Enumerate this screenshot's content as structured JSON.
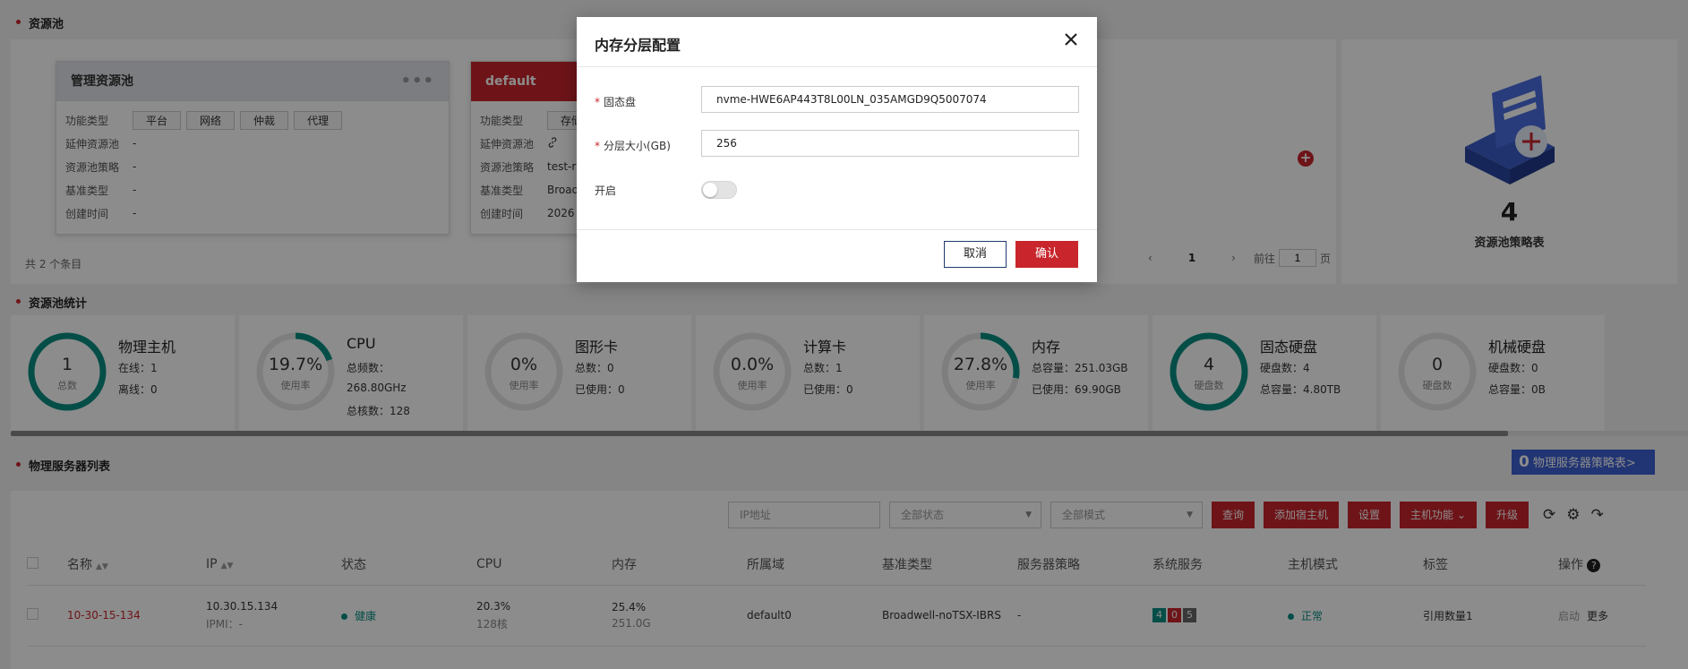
{
  "pool": {
    "section_title": "资源池",
    "cards": [
      {
        "name": "管理资源池",
        "more": "•••",
        "function_type_label": "功能类型",
        "tags": [
          "平台",
          "网络",
          "仲裁",
          "代理"
        ],
        "ext_label": "延伸资源池",
        "ext_value": "-",
        "policy_label": "资源池策略",
        "policy_value": "-",
        "baseline_label": "基准类型",
        "baseline_value": "-",
        "created_label": "创建时间",
        "created_value": "-"
      },
      {
        "name": "default",
        "function_type_label": "功能类型",
        "tags": [
          "存储"
        ],
        "ext_label": "延伸资源池",
        "policy_label": "资源池策略",
        "policy_value": "test-r",
        "baseline_label": "基准类型",
        "baseline_value": "Broad",
        "created_label": "创建时间",
        "created_value": "2026"
      }
    ],
    "total": "共 2 个条目",
    "add_symbol": "+",
    "pager": {
      "prev": "‹",
      "current": "1",
      "next": "›",
      "goto_label": "前往",
      "goto_value": "1",
      "page_unit": "页"
    },
    "strategy_count": "4",
    "strategy_label": "资源池策略表"
  },
  "stats": {
    "section_title": "资源池统计",
    "items": [
      {
        "value": "1",
        "sub": "总数",
        "name": "物理主机",
        "lines": [
          "在线：1",
          "离线：0"
        ],
        "percent": 100
      },
      {
        "value": "19.7%",
        "sub": "使用率",
        "name": "CPU",
        "lines": [
          "总频数：",
          "268.80GHz",
          "总核数：128"
        ],
        "percent": 19.7
      },
      {
        "value": "0%",
        "sub": "使用率",
        "name": "图形卡",
        "lines": [
          "总数：0",
          "已使用：0"
        ],
        "percent": 0
      },
      {
        "value": "0.0%",
        "sub": "使用率",
        "name": "计算卡",
        "lines": [
          "总数：1",
          "已使用：0"
        ],
        "percent": 0
      },
      {
        "value": "27.8%",
        "sub": "使用率",
        "name": "内存",
        "lines": [
          "总容量：251.03GB",
          "已使用：69.90GB"
        ],
        "percent": 27.8
      },
      {
        "value": "4",
        "sub": "硬盘数",
        "name": "固态硬盘",
        "lines": [
          "硬盘数：4",
          "总容量：4.80TB"
        ],
        "percent": 100
      },
      {
        "value": "0",
        "sub": "硬盘数",
        "name": "机械硬盘",
        "lines": [
          "硬盘数：0",
          "总容量：0B"
        ],
        "percent": 0
      }
    ],
    "colors": {
      "ring_fill": "#0a8f83",
      "ring_track": "#e6e6e6"
    }
  },
  "servers": {
    "section_title": "物理服务器列表",
    "strategy_count": "0",
    "strategy_label": "物理服务器策略表>",
    "ip_placeholder": "IP地址",
    "status_filter": "全部状态",
    "mode_filter": "全部模式",
    "buttons": {
      "query": "查询",
      "add_host": "添加宿主机",
      "settings": "设置",
      "host_func": "主机功能",
      "upgrade": "升级"
    },
    "columns": [
      "名称",
      "IP",
      "状态",
      "CPU",
      "内存",
      "所属域",
      "基准类型",
      "服务器策略",
      "系统服务",
      "主机模式",
      "标签",
      "操作"
    ],
    "rows": [
      {
        "name": "10-30-15-134",
        "ip": "10.30.15.134",
        "ipmi": "IPMI：-",
        "status": "健康",
        "cpu": "20.3%",
        "cpu_sub": "128核",
        "mem": "25.4%",
        "mem_sub": "251.0G",
        "domain": "default0",
        "baseline": "Broadwell-noTSX-IBRS",
        "policy": "-",
        "svc": [
          "4",
          "0",
          "5"
        ],
        "mode": "正常",
        "tag": "引用数量1",
        "action_start": "启动",
        "action_more": "更多"
      }
    ]
  },
  "modal": {
    "title": "内存分层配置",
    "ssd_label": "固态盘",
    "ssd_value": "nvme-HWE6AP443T8L00LN_035AMGD9Q5007074",
    "size_label": "分层大小(GB)",
    "size_value": "256",
    "enable_label": "开启",
    "enable_state": "off",
    "required_mark": "*",
    "cancel": "取消",
    "confirm": "确认"
  },
  "colors": {
    "accent": "#c8262c",
    "teal": "#0a8f83",
    "blue": "#3d5fd1",
    "overlay": "rgba(0,0,0,0.45)"
  }
}
